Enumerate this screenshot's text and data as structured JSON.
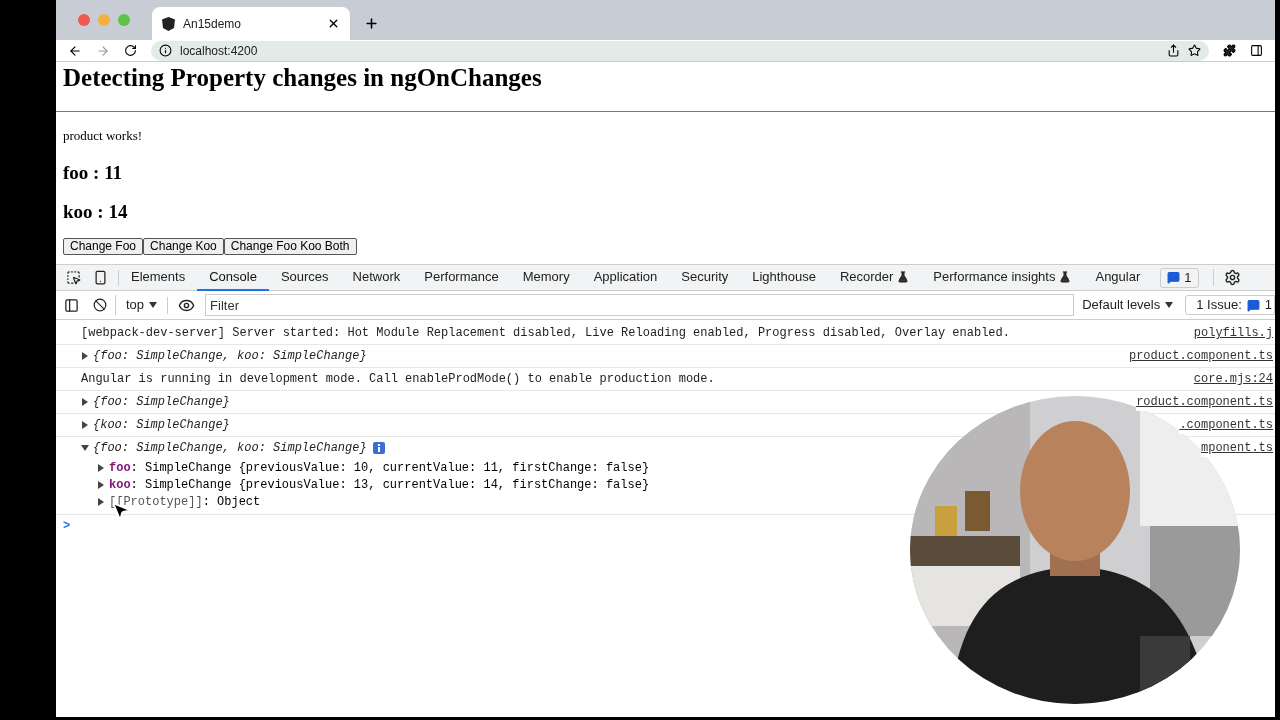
{
  "browser": {
    "tab_title": "An15demo",
    "url": "localhost:4200"
  },
  "page": {
    "heading": "Detecting Property changes in ngOnChanges",
    "message": "product works!",
    "values": [
      "foo : 11",
      "koo : 14"
    ],
    "buttons": [
      "Change Foo",
      "Change Koo",
      "Change Foo Koo Both"
    ]
  },
  "devtools": {
    "tabs": [
      {
        "label": "Elements",
        "selected": false,
        "experimental": false
      },
      {
        "label": "Console",
        "selected": true,
        "experimental": false
      },
      {
        "label": "Sources",
        "selected": false,
        "experimental": false
      },
      {
        "label": "Network",
        "selected": false,
        "experimental": false
      },
      {
        "label": "Performance",
        "selected": false,
        "experimental": false
      },
      {
        "label": "Memory",
        "selected": false,
        "experimental": false
      },
      {
        "label": "Application",
        "selected": false,
        "experimental": false
      },
      {
        "label": "Security",
        "selected": false,
        "experimental": false
      },
      {
        "label": "Lighthouse",
        "selected": false,
        "experimental": false
      },
      {
        "label": "Recorder",
        "selected": false,
        "experimental": true
      },
      {
        "label": "Performance insights",
        "selected": false,
        "experimental": true
      },
      {
        "label": "Angular",
        "selected": false,
        "experimental": false
      }
    ],
    "issues_count": "1",
    "context": "top",
    "filter_placeholder": "Filter",
    "levels": "Default levels",
    "issues_label": "1 Issue:",
    "issues_badge": "1"
  },
  "console": {
    "rows": [
      {
        "kind": "text",
        "text": "[webpack-dev-server] Server started: Hot Module Replacement disabled, Live Reloading enabled, Progress disabled, Overlay enabled.",
        "source": "polyfills.j"
      },
      {
        "kind": "object",
        "expanded": false,
        "text": "{foo: SimpleChange, koo: SimpleChange}",
        "source": "product.component.ts"
      },
      {
        "kind": "text",
        "text": "Angular is running in development mode. Call enableProdMode() to enable production mode.",
        "source": "core.mjs:24"
      },
      {
        "kind": "object",
        "expanded": false,
        "text": "{foo: SimpleChange}",
        "source": "roduct.component.ts"
      },
      {
        "kind": "object",
        "expanded": false,
        "text": "{koo: SimpleChange}",
        "source": ".component.ts"
      },
      {
        "kind": "object",
        "expanded": true,
        "text": "{foo: SimpleChange, koo: SimpleChange}",
        "source": "mponent.ts",
        "children": [
          {
            "kind": "change",
            "key": "foo",
            "value": ": SimpleChange {previousValue: 10, currentValue: 11, firstChange: false}"
          },
          {
            "kind": "change",
            "key": "koo",
            "value": ": SimpleChange {previousValue: 13, currentValue: 14, firstChange: false}"
          },
          {
            "kind": "prototype",
            "key": "[[Prototype]]",
            "value": ": Object"
          }
        ]
      }
    ],
    "prompt": ">"
  }
}
